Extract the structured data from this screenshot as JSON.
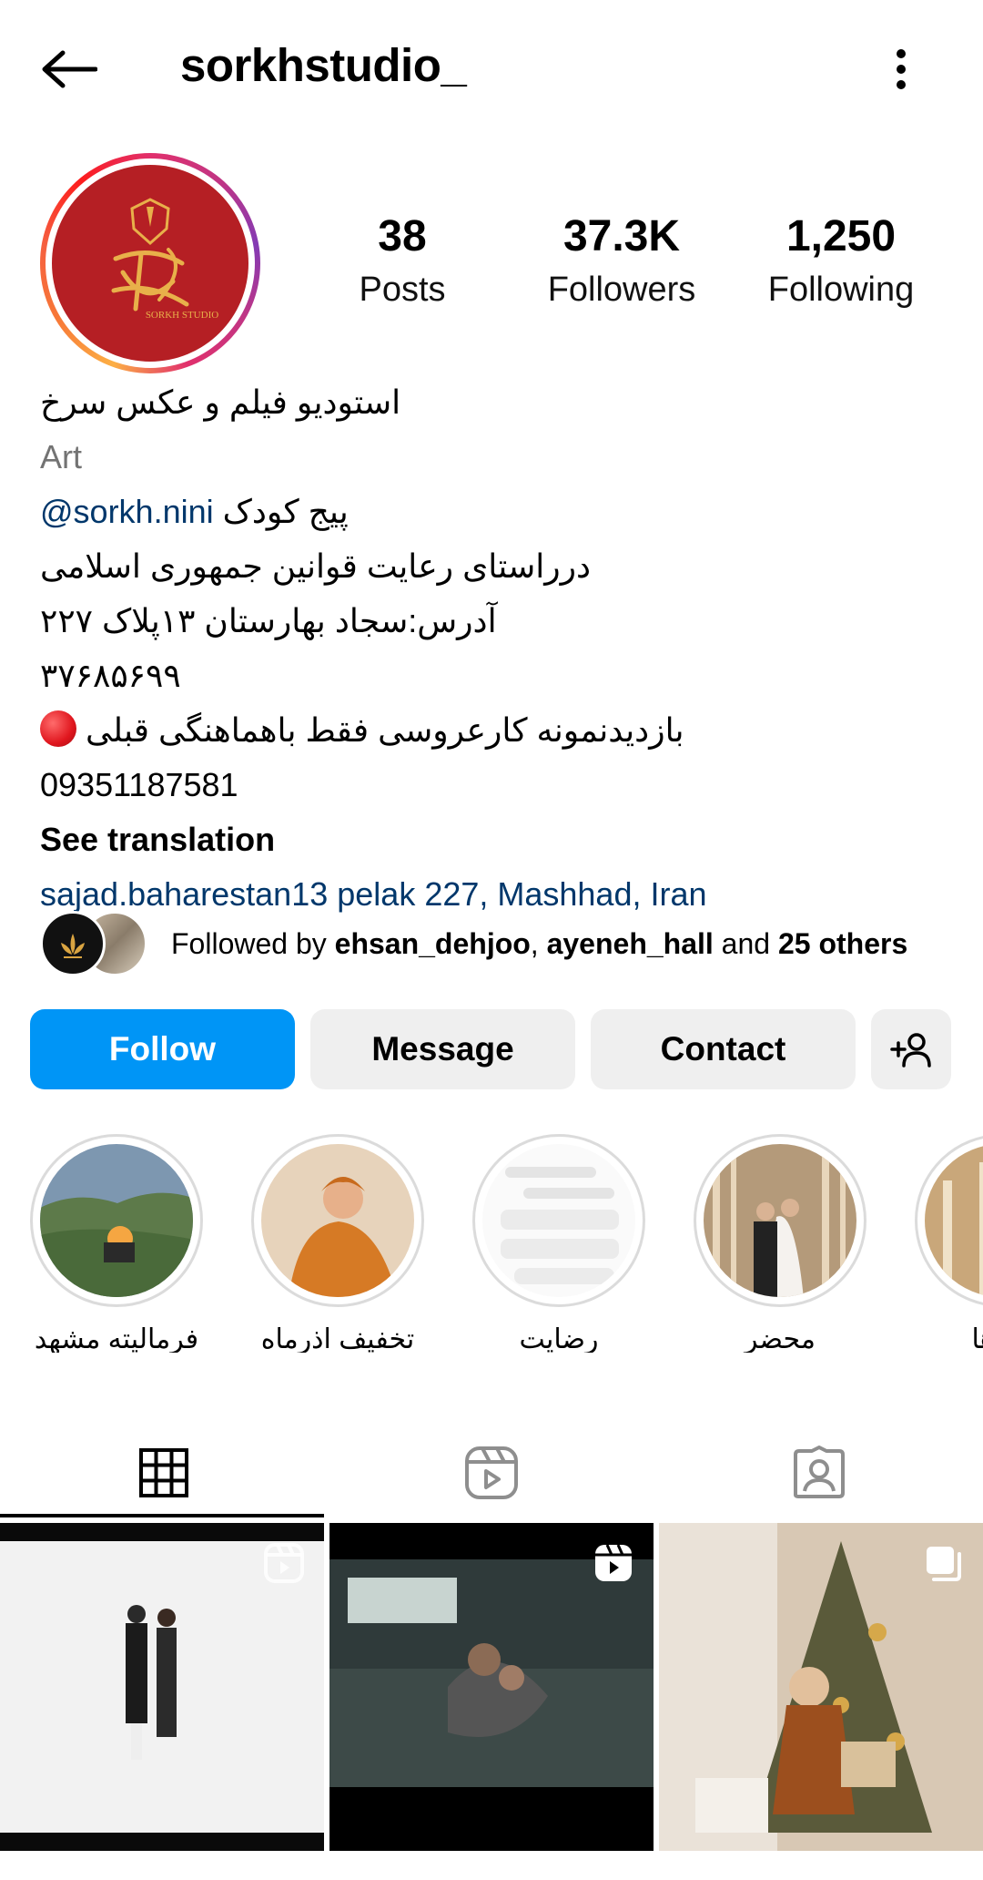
{
  "header": {
    "username": "sorkhstudio_"
  },
  "profile": {
    "avatar_text": "SORKH STUDIO",
    "stats": [
      {
        "num": "38",
        "label": "Posts"
      },
      {
        "num": "37.3K",
        "label": "Followers"
      },
      {
        "num": "1,250",
        "label": "Following"
      }
    ],
    "bio": {
      "name": "استودیو فیلم و عکس سرخ",
      "category": "Art",
      "kids_page_label": "پیج کودک",
      "kids_page_handle": "@sorkh.nini",
      "line_law": "درراستای رعایت قوانین جمهوری اسلامی",
      "line_address": "آدرس:سجاد بهارستان ۱۳پلاک ۲۲۷",
      "line_phone1": "۳۷۶۸۵۶۹۹",
      "line_visit": "بازدیدنمونه کارعروسی فقط باهماهنگی قبلی",
      "line_phone2": "09351187581",
      "see_translation": "See translation",
      "location": "sajad.baharestan13 pelak 227, Mashhad, Iran"
    },
    "followed_by": {
      "prefix": "Followed by ",
      "user1": "ehsan_dehjoo",
      "sep": ", ",
      "user2": "ayeneh_hall",
      "and": " and ",
      "others": "25 others"
    }
  },
  "buttons": {
    "follow": "Follow",
    "message": "Message",
    "contact": "Contact"
  },
  "highlights": [
    {
      "label": "فرمالیته مشهد"
    },
    {
      "label": "تخفیف اذرماه"
    },
    {
      "label": "رضایت"
    },
    {
      "label": "محضر"
    },
    {
      "label": "الارها"
    }
  ],
  "tabs": [
    "grid-tab",
    "reels-tab",
    "tagged-tab"
  ],
  "colors": {
    "follow_blue": "#0095f6",
    "link_blue": "#00376b",
    "brand_red": "#b51f24"
  }
}
